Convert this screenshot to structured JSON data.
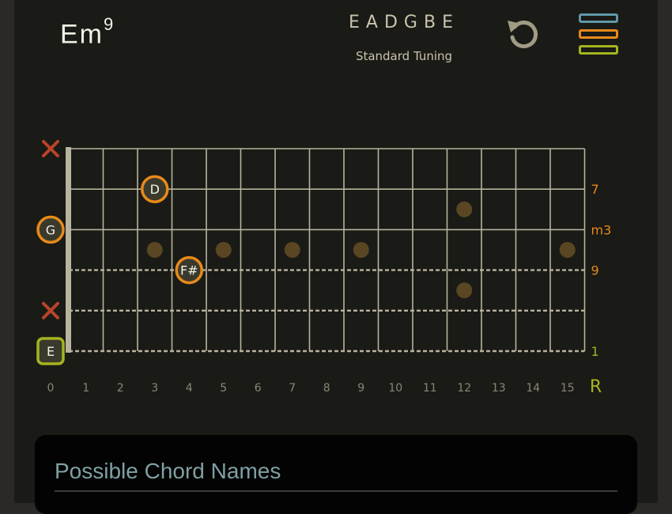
{
  "header": {
    "chord_root": "Em",
    "chord_ext": "9",
    "tuning_notes": "EADGBE",
    "tuning_name": "Standard Tuning",
    "reset_icon": "reset-icon",
    "menu_icon": "menu-icon"
  },
  "colors": {
    "background": "#1a1a16",
    "frame": "#2a2925",
    "accent_orange": "#e88a1a",
    "accent_green": "#a6b320",
    "accent_blue": "#5e97a9",
    "mute_red": "#b9432b",
    "fret_line": "#b8b39e",
    "inlay": "#5a4623",
    "card_title": "#7fa0a4"
  },
  "fretboard": {
    "fret_numbers": [
      "0",
      "1",
      "2",
      "3",
      "4",
      "5",
      "6",
      "7",
      "8",
      "9",
      "10",
      "11",
      "12",
      "13",
      "14",
      "15"
    ],
    "root_label": "R",
    "strings": [
      {
        "name": "high-e",
        "open": "mute",
        "dashed": false,
        "interval": ""
      },
      {
        "name": "b",
        "open": "",
        "dashed": false,
        "interval": "7"
      },
      {
        "name": "g",
        "open": "G",
        "dashed": false,
        "interval": "m3"
      },
      {
        "name": "d",
        "open": "",
        "dashed": true,
        "interval": "9"
      },
      {
        "name": "a",
        "open": "mute",
        "dashed": true,
        "interval": ""
      },
      {
        "name": "low-e",
        "open": "E",
        "dashed": true,
        "interval": "1"
      }
    ],
    "notes": [
      {
        "string": 1,
        "fret": 3,
        "label": "D"
      },
      {
        "string": 3,
        "fret": 4,
        "label": "F#"
      }
    ],
    "inlays": [
      {
        "fret": 3,
        "position": "middle"
      },
      {
        "fret": 5,
        "position": "middle"
      },
      {
        "fret": 7,
        "position": "middle"
      },
      {
        "fret": 9,
        "position": "middle"
      },
      {
        "fret": 12,
        "position": "upper"
      },
      {
        "fret": 12,
        "position": "lower"
      },
      {
        "fret": 15,
        "position": "middle"
      }
    ]
  },
  "panel": {
    "title": "Possible Chord Names"
  }
}
